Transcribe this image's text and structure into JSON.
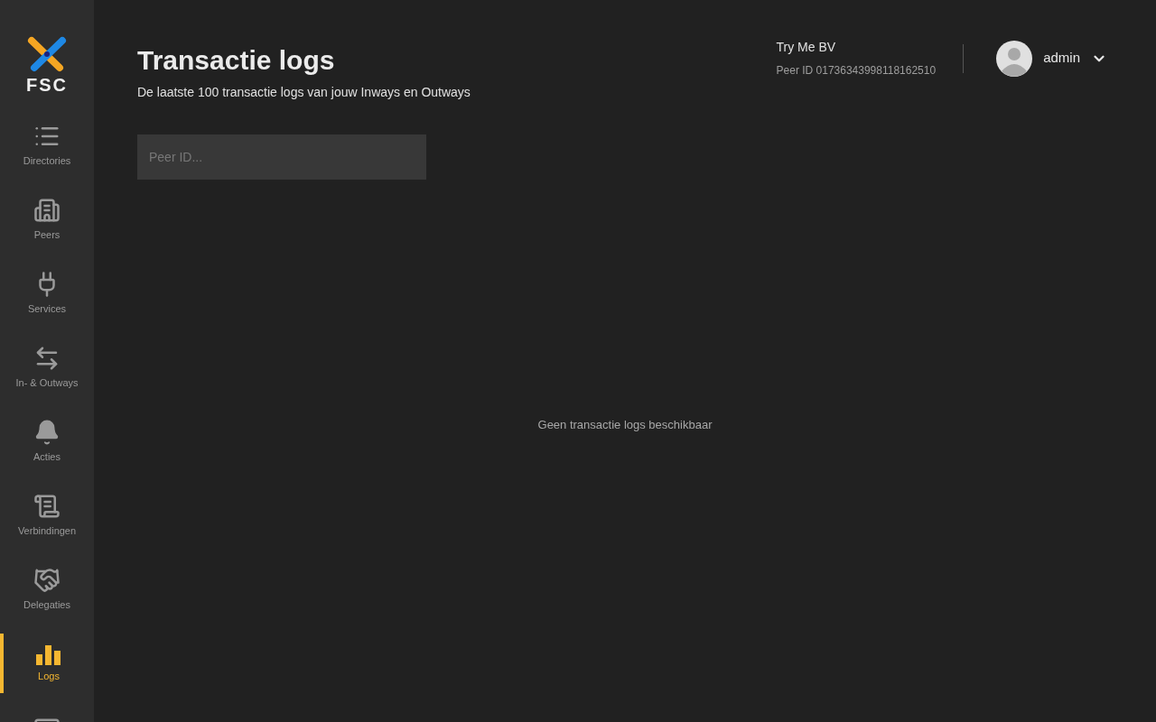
{
  "logo": {
    "text": "FSC"
  },
  "sidebar": {
    "items": [
      {
        "label": "Directories",
        "selected": false
      },
      {
        "label": "Peers",
        "selected": false
      },
      {
        "label": "Services",
        "selected": false
      },
      {
        "label": "In- & Outways",
        "selected": false
      },
      {
        "label": "Acties",
        "selected": false
      },
      {
        "label": "Verbindingen",
        "selected": false
      },
      {
        "label": "Delegaties",
        "selected": false
      },
      {
        "label": "Logs",
        "selected": true
      }
    ]
  },
  "header": {
    "title": "Transactie logs",
    "subtitle": "De laatste 100 transactie logs van jouw Inways en Outways",
    "organization": "Try Me BV",
    "peer_id": "Peer ID 01736343998118162510",
    "user": "admin"
  },
  "search": {
    "placeholder": "Peer ID..."
  },
  "empty_message": "Geen transactie logs beschikbaar"
}
